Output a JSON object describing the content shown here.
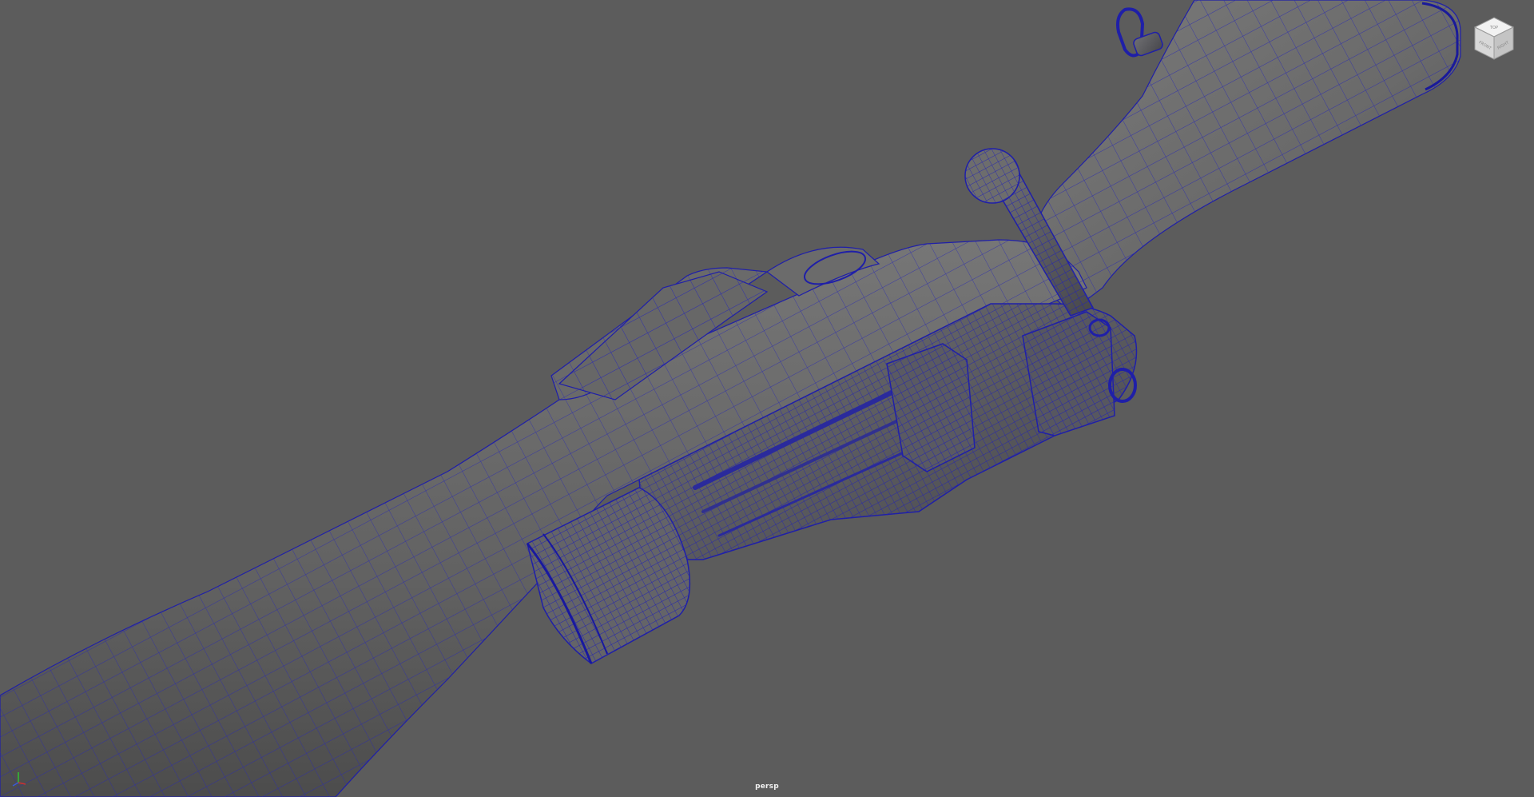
{
  "viewport": {
    "camera_label": "persp",
    "background": "#5c5c5c",
    "wire_color": "#1f1fa8",
    "mesh_color": "#6e6e6e"
  },
  "viewcube": {
    "faces": [
      "TOP",
      "FRONT",
      "RIGHT"
    ]
  },
  "axis_gizmo": {
    "axes": [
      "X",
      "Y",
      "Z"
    ],
    "colors": {
      "x": "#d03030",
      "y": "#30c030",
      "z": "#3a5ad8"
    }
  },
  "model": {
    "icon": "rifle-wireframe-model"
  }
}
